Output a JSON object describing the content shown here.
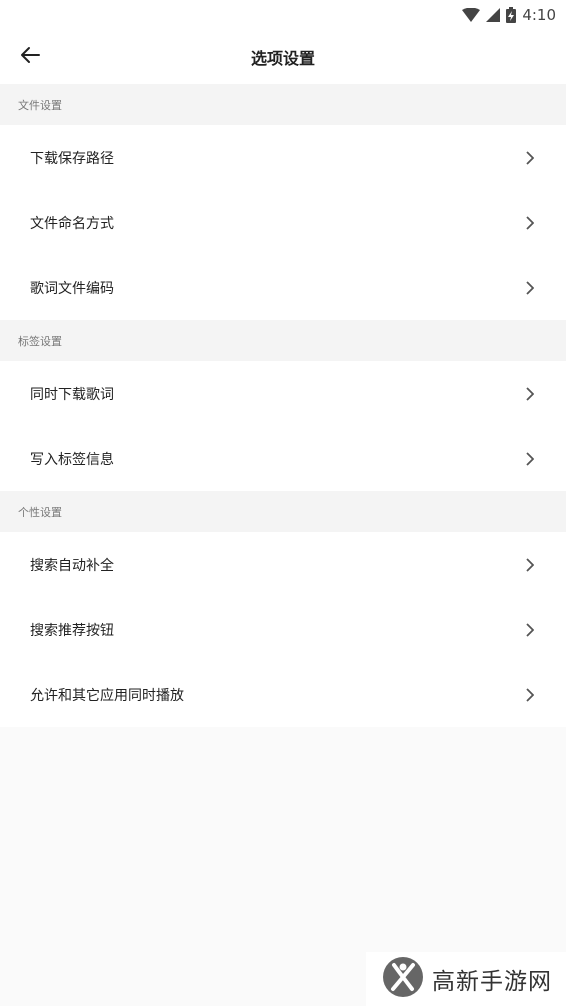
{
  "status_bar": {
    "time": "4:10",
    "icons": [
      "wifi-icon",
      "cellular-signal-icon",
      "battery-charging-icon"
    ]
  },
  "header": {
    "title": "选项设置",
    "back_icon": "arrow-left-icon"
  },
  "sections": [
    {
      "title": "文件设置",
      "items": [
        {
          "label": "下载保存路径"
        },
        {
          "label": "文件命名方式"
        },
        {
          "label": "歌词文件编码"
        }
      ]
    },
    {
      "title": "标签设置",
      "items": [
        {
          "label": "同时下载歌词"
        },
        {
          "label": "写入标签信息"
        }
      ]
    },
    {
      "title": "个性设置",
      "items": [
        {
          "label": "搜索自动补全"
        },
        {
          "label": "搜索推荐按钮"
        },
        {
          "label": "允许和其它应用同时播放"
        }
      ]
    }
  ],
  "watermark": {
    "text": "高新手游网"
  },
  "colors": {
    "background": "#fafafa",
    "section_header": "#f4f4f4",
    "item_background": "#ffffff",
    "chevron": "#555555"
  }
}
